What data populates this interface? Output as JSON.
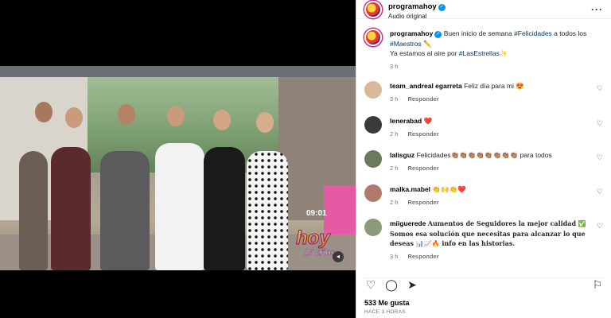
{
  "post": {
    "account": "programahoy",
    "audio": "Audio original",
    "verified_badge": "✓"
  },
  "caption": {
    "username": "programahoy",
    "text_part1": "Buen inicio de semana ",
    "hashtag1": "#Felicidades",
    "text_part2": " a todos los ",
    "hashtag2": "#Maestros",
    "emoji1": "✏️",
    "line2_text": "Ya estamos al aire por ",
    "hashtag3": "#LasEstrellas",
    "emoji2": "✨",
    "time": "3 h"
  },
  "comments": [
    {
      "username": "team_andreal egarreta",
      "text": "Feliz día para mi 😍",
      "time": "3 h",
      "reply": "Responder",
      "avatar_color": "#d9b99a"
    },
    {
      "username": "lenerabad",
      "text": "❤️",
      "time": "2 h",
      "reply": "Responder",
      "avatar_color": "#3a3a3a"
    },
    {
      "username": "lalisguz",
      "text": "Felicidades👏🏽👏🏽👏🏽👏🏽👏🏽👏🏽👏🏽👏🏽 para todos",
      "time": "2 h",
      "reply": "Responder",
      "avatar_color": "#6b7a5b"
    },
    {
      "username": "malka.mabel",
      "text": "👏🙌👏❤️",
      "time": "2 h",
      "reply": "Responder",
      "avatar_color": "#b07a6a"
    },
    {
      "username": "miiguerede",
      "text": "Aumentos de Seguidores la mejor calidad ✅ Somos esa solución que necesitas para alcanzar lo que deseas 📊📈🔥 info en las historias.",
      "time": "3 h",
      "reply": "Responder",
      "avatar_color": "#8a9a7a"
    }
  ],
  "actions": {
    "like_icon": "heart-icon",
    "comment_icon": "comment-icon",
    "share_icon": "share-icon",
    "save_icon": "bookmark-icon"
  },
  "likes": "533 Me gusta",
  "posted_ago": "HACE 3 HORAS",
  "video": {
    "logo_text": "hoy",
    "logo_sub": "25 años",
    "timestamp": "09:01"
  }
}
